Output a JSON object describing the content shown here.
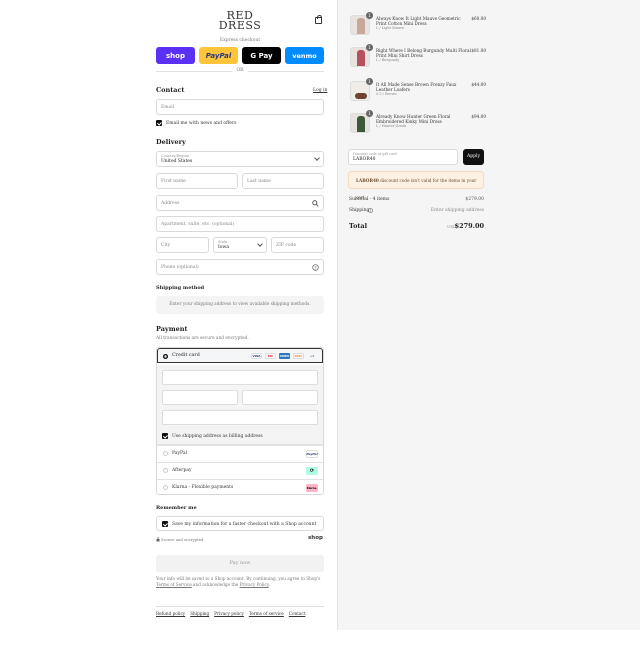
{
  "brand": {
    "line1": "RED",
    "line2": "DRESS"
  },
  "express_label": "Express checkout",
  "express_buttons": {
    "shop": "shop",
    "paypal": "PayPal",
    "gpay": "G Pay",
    "venmo": "venmo"
  },
  "or_label": "OR",
  "contact": {
    "heading": "Contact",
    "login_link": "Log in",
    "email_placeholder": "Email",
    "news_label": "Email me with news and offers",
    "news_checked": true
  },
  "delivery": {
    "heading": "Delivery",
    "country_label": "Country/Region",
    "country_value": "United States",
    "first_name": "First name",
    "last_name": "Last name",
    "address": "Address",
    "apartment": "Apartment, suite, etc. (optional)",
    "city": "City",
    "state_label": "State",
    "state_value": "Iowa",
    "zip": "ZIP code",
    "phone": "Phone (optional)"
  },
  "shipping_method": {
    "heading": "Shipping method",
    "message": "Enter your shipping address to view available shipping methods."
  },
  "payment": {
    "heading": "Payment",
    "subtitle": "All transactions are secure and encrypted.",
    "credit_card_label": "Credit card",
    "card_brands": [
      "VISA",
      "MC",
      "AMEX",
      "DISC"
    ],
    "more_cards": "+4",
    "billing_same_label": "Use shipping address as billing address",
    "alt_methods": [
      {
        "label": "PayPal",
        "badge": "PayPal"
      },
      {
        "label": "Afterpay",
        "badge": "⟳"
      },
      {
        "label": "Klarna - Flexible payments",
        "badge": "Klarna."
      }
    ]
  },
  "remember": {
    "heading": "Remember me",
    "save_label": "Save my information for a faster checkout with a Shop account",
    "secure_label": "Secure and encrypted",
    "shop_logo": "shop"
  },
  "pay_now": "Pay now",
  "legal": {
    "text": "Your info will be saved to a Shop account. By continuing, you agree to Shop's ",
    "terms_link": "Terms of Service",
    "middle": " and acknowledge the ",
    "privacy_link": "Privacy Policy",
    "end": "."
  },
  "footer_links": [
    "Refund policy",
    "Shipping",
    "Privacy policy",
    "Terms of service",
    "Contact"
  ],
  "order": {
    "items": [
      {
        "name": "Always Know It Light Mauve Geometric Print Cotton Mini Dress",
        "variant": "L / Light Mauve",
        "price": "$60.00",
        "qty": "1"
      },
      {
        "name": "Right Where I Belong Burgundy Multi Floral Print Mini Shirt Dress",
        "variant": "L / Burgundy",
        "price": "$81.00",
        "qty": "1"
      },
      {
        "name": "It All Made Sense Brown Frenzy Faux Leather Loafers",
        "variant": "5.5 / Brown",
        "price": "$44.00",
        "qty": "1"
      },
      {
        "name": "Already Know Hunter Green Floral Embroidered Kinky Mini Dress",
        "variant": "L / Hunter Green",
        "price": "$94.00",
        "qty": "1"
      }
    ],
    "discount_label": "Discount code or gift card",
    "discount_value": "LABOR40",
    "apply_label": "Apply",
    "discount_code_msg": "LABOR40",
    "discount_msg_text": " discount code isn't valid for the items in your cart",
    "subtotal_label": "Subtotal · 4 items",
    "subtotal_value": "$279.00",
    "shipping_label": "Shipping",
    "shipping_value": "Enter shipping address",
    "total_label": "Total",
    "currency": "USD",
    "total_value": "$279.00"
  }
}
